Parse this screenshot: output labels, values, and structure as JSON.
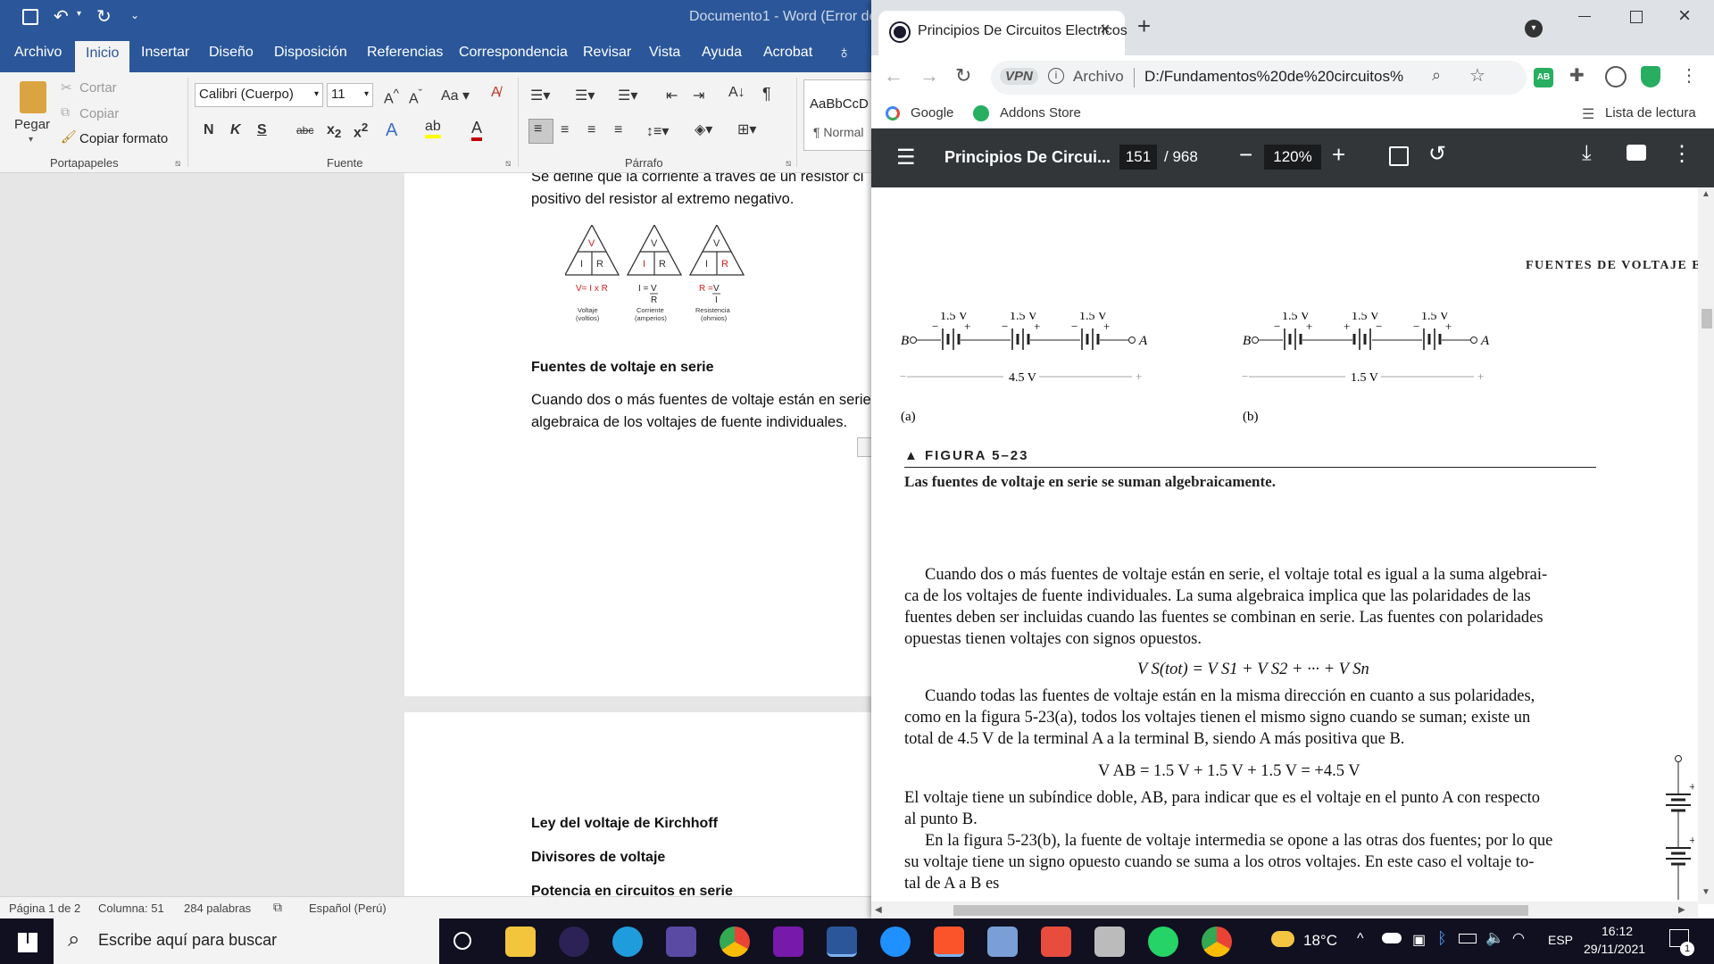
{
  "word": {
    "title": "Documento1  -  Word (Error de",
    "tabs": [
      "Archivo",
      "Inicio",
      "Insertar",
      "Diseño",
      "Disposición",
      "Referencias",
      "Correspondencia",
      "Revisar",
      "Vista",
      "Ayuda",
      "Acrobat"
    ],
    "clipboard": {
      "paste": "Pegar",
      "cut": "Cortar",
      "copy": "Copiar",
      "format_painter": "Copiar formato",
      "group": "Portapapeles"
    },
    "font": {
      "name": "Calibri (Cuerpo)",
      "size": "11",
      "group": "Fuente",
      "bold": "N",
      "italic": "K",
      "underline": "S",
      "strike": "abc"
    },
    "paragraph": {
      "group": "Párrafo"
    },
    "styles": {
      "preview": "AaBbCcD",
      "normal": "¶ Normal"
    },
    "doc": {
      "line1": "Se define que la corriente a través de un resistor ci",
      "line2": "positivo del resistor al extremo negativo.",
      "tri_top": "V",
      "tri_left": "I",
      "tri_right": "R",
      "formula1": "V= I x R",
      "formula2_left": "I =",
      "formula2_num": "V",
      "formula2_den": "R",
      "formula3_left": "R =",
      "formula3_num": "V",
      "formula3_den": "I",
      "cap1a": "Voltaje",
      "cap1b": "(voltios)",
      "cap2a": "Corriente",
      "cap2b": "(amperios)",
      "cap3a": "Resistencia",
      "cap3b": "(ohmios)",
      "heading1": "Fuentes de voltaje en serie",
      "para1a": "Cuando dos o más fuentes de voltaje están en serie",
      "para1b": "algebraica de los voltajes de fuente individuales.",
      "heading2": "Ley del voltaje de Kirchhoff",
      "heading3": "Divisores de voltaje",
      "heading4": "Potencia en circuitos en serie"
    },
    "status": {
      "page": "Página 1 de 2",
      "column": "Columna: 51",
      "words": "284 palabras",
      "lang": "Español (Perú)"
    }
  },
  "chrome": {
    "tab_title": "Principios De Circuitos Electricos",
    "vpn": "VPN",
    "scheme_label": "Archivo",
    "url": "D:/Fundamentos%20de%20circuitos%20...",
    "bookmarks": [
      "Google",
      "Addons Store"
    ],
    "reading_list": "Lista de lectura"
  },
  "pdf": {
    "title": "Principios De Circui...",
    "page": "151",
    "total": "/ 968",
    "zoom": "120%",
    "running_head": "Fuentes de voltaje en",
    "cell_v": "1.5 V",
    "total_a": "4.5 V",
    "total_b": "1.5 V",
    "label_a": "(a)",
    "label_b": "(b)",
    "node_b": "B",
    "node_a": "A",
    "plus": "+",
    "minus": "−",
    "fig_label": "▲ FIGURA 5–23",
    "fig_caption": "Las fuentes de voltaje en serie se suman algebraicamente.",
    "p1": [
      "Cuando dos o más fuentes de voltaje están en serie, el voltaje total es igual a la suma algebrai-",
      "ca de los voltajes de fuente individuales. La suma algebraica implica que las polaridades de las",
      "fuentes deben ser incluidas cuando las fuentes se combinan en serie. Las fuentes con polaridades",
      "opuestas tienen voltajes con signos opuestos."
    ],
    "eq1": "V S(tot) = V S1 + V S2 + ··· + V Sn",
    "p2": [
      "Cuando todas las fuentes de voltaje están en la misma dirección en cuanto a sus polaridades,",
      "como en la figura 5-23(a), todos los voltajes tienen el mismo signo cuando se suman; existe un",
      "total de 4.5 V de la terminal A a la terminal B, siendo A más positiva que B."
    ],
    "eq2": "V AB = 1.5 V + 1.5 V + 1.5 V = +4.5 V",
    "p3": [
      "El voltaje tiene un subíndice doble, AB, para indicar que es el voltaje en el punto A con respecto",
      "al punto B."
    ],
    "p4": [
      "En la figura 5-23(b), la fuente de voltaje intermedia se opone a las otras dos fuentes; por lo que",
      "su voltaje tiene un signo opuesto cuando se suma a los otros voltajes. En este caso el voltaje to-",
      "tal de A a B es"
    ]
  },
  "taskbar": {
    "search_placeholder": "Escribe aquí para buscar",
    "weather": "18°C",
    "lang": "ESP",
    "time": "16:12",
    "date": "29/11/2021",
    "notif": "1"
  },
  "colors": {
    "word_blue": "#2b579a",
    "pdf_toolbar": "#323639",
    "chrome_tabbar": "#dee1e6",
    "taskbar": "#101020"
  }
}
